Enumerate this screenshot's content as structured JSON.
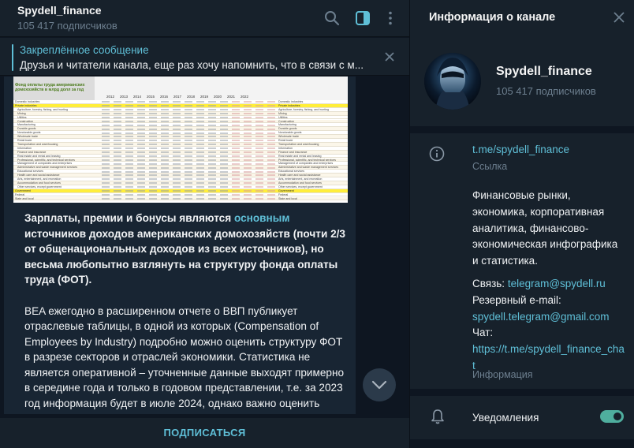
{
  "chat": {
    "title": "Spydell_finance",
    "subscribers": "105 417 подписчиков",
    "icons": {
      "search": "search-icon",
      "panel": "sidebar-panel-icon",
      "more": "more-vertical-icon"
    }
  },
  "pinned": {
    "title": "Закреплённое сообщение",
    "text": "Друзья и читатели канала, еще раз хочу напомнить, что в связи с м..."
  },
  "message": {
    "image": {
      "title_lines": [
        "Фонд оплаты труда американских",
        "домохозяйств в млрд долл за год"
      ],
      "rows": [
        "Domestic industries",
        "Private industries",
        "Agriculture, forestry, fishing, and hunting",
        "Mining",
        "Utilities",
        "Construction",
        "Manufacturing",
        "Durable goods",
        "Nondurable goods",
        "Wholesale trade",
        "Retail trade",
        "Transportation and warehousing",
        "Information",
        "Finance and insurance",
        "Real estate and rental and leasing",
        "Professional, scientific, and technical services",
        "Management of companies and enterprises",
        "Administrative and waste management services",
        "Educational services",
        "Health care and social assistance",
        "Arts, entertainment, and recreation",
        "Accommodation and food services",
        "Other services, except government",
        "Government",
        "Federal",
        "State and local"
      ],
      "highlight_rows": [
        1,
        23
      ],
      "years": [
        "2012",
        "2013",
        "2014",
        "2015",
        "2016",
        "2017",
        "2018",
        "2019",
        "2020",
        "2021",
        "2022"
      ]
    },
    "para1_a": "Зарплаты, премии и бонусы являются ",
    "para1_link": "основным",
    "para1_b": " источников доходов американских домохозяйств (почти 2/3 от общенациональных доходов из всех источников), но весьма любопытно взглянуть на структуру фонда оплаты труда (ФОТ).",
    "para2": "BEA ежегодно в расширенном отчете о ВВП публикует отраслевые таблицы, в одной из которых (Compensation of Employees by Industry) подробно можно оценить структуру ФОТ в разрезе секторов и отраслей экономики. Статистика не является оперативной – уточненные данные выходят примерно в середине года и только в годовом представлении, т.е. за 2023 год информация будет в июле 2024, однако важно оценить"
  },
  "subscribe": {
    "label": "ПОДПИСАТЬСЯ"
  },
  "info": {
    "title": "Информация о канале",
    "name": "Spydell_finance",
    "subscribers": "105 417 подписчиков",
    "link": "t.me/spydell_finance",
    "link_caption": "Ссылка",
    "description": "Финансовые рынки, экономика, корпоративная аналитика, финансово-экономическая инфографика и статистика.",
    "contact_label": "Связь: ",
    "contact_link": "telegram@spydell.ru",
    "email_label": "Резервный e-mail:",
    "email_link": "spydell.telegram@gmail.com",
    "chat_label": "Чат:",
    "chat_link": "https://t.me/spydell_finance_chat",
    "about_caption": "Информация",
    "notifications_label": "Уведомления",
    "notifications_on": true
  },
  "colors": {
    "accent": "#5fbfd7",
    "toggle": "#4fae9e",
    "panel": "#17212b",
    "background": "#0e1621",
    "bubble": "#182533"
  }
}
